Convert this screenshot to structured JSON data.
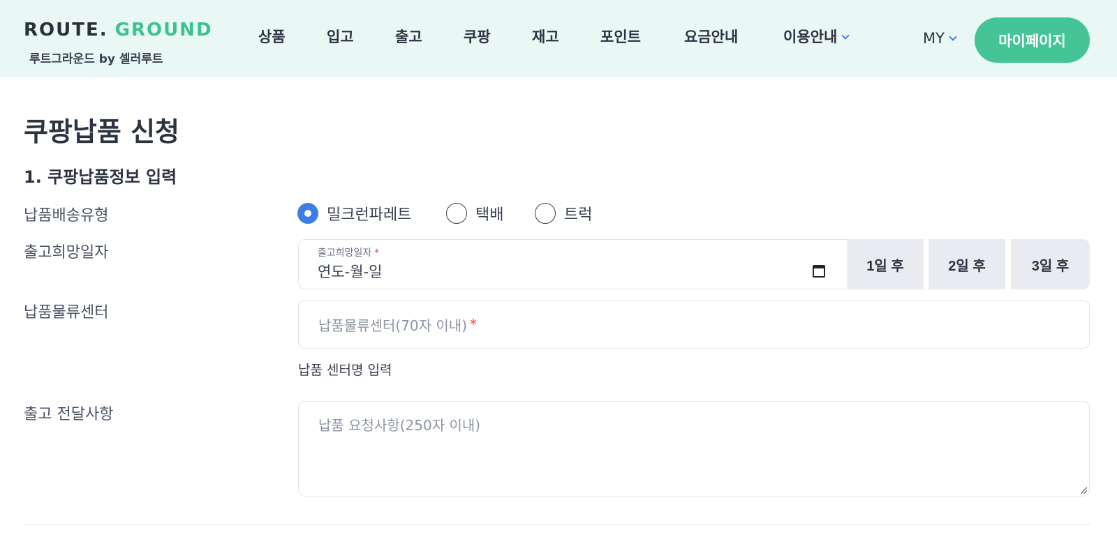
{
  "header": {
    "logo_route": "ROUTE.",
    "logo_ground": "GROUND",
    "logo_sub": "루트그라운드 by 셀러루트",
    "nav": [
      "상품",
      "입고",
      "출고",
      "쿠팡",
      "재고",
      "포인트",
      "요금안내",
      "이용안내"
    ],
    "my_label": "MY",
    "mypage_label": "마이페이지"
  },
  "page": {
    "title": "쿠팡납품 신청",
    "section_title": "1. 쿠팡납품정보 입력"
  },
  "form": {
    "delivery_type": {
      "label": "납품배송유형",
      "options": [
        "밀크런파레트",
        "택배",
        "트럭"
      ],
      "selected": "밀크런파레트"
    },
    "ship_date": {
      "label": "출고희망일자",
      "caption": "출고희망일자",
      "required_mark": "*",
      "value": "연도-월-일",
      "quick_buttons": [
        "1일 후",
        "2일 후",
        "3일 후"
      ]
    },
    "center": {
      "label": "납품물류센터",
      "placeholder": "납품물류센터(70자 이내)",
      "required_mark": "*",
      "helper": "납품 센터명 입력"
    },
    "message": {
      "label": "출고 전달사항",
      "placeholder": "납품 요청사항(250자 이내)"
    }
  },
  "colors": {
    "header_bg": "#eaf8f5",
    "accent_green": "#45c497",
    "logo_green": "#3cc28e",
    "radio_blue": "#3f7de6",
    "required_red": "#e54848"
  }
}
